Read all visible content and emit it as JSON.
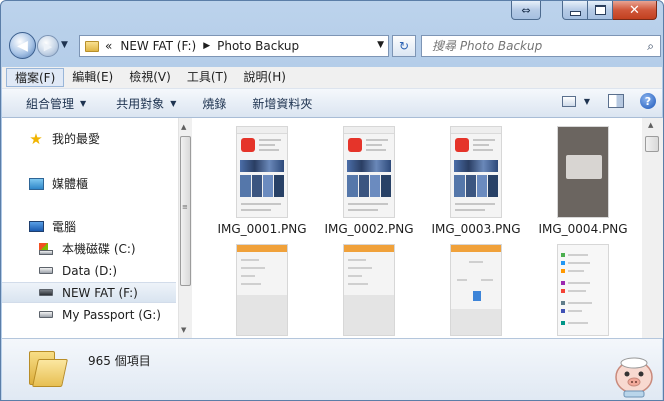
{
  "window": {
    "controls": {
      "minimize": "minimize",
      "maximize": "maximize",
      "close": "close",
      "restore_tb": "restore-down"
    }
  },
  "nav": {
    "breadcrumb_overflow": "«",
    "breadcrumb": [
      "NEW FAT (F:)",
      "Photo Backup"
    ],
    "search_placeholder": "搜尋 Photo Backup"
  },
  "menubar": [
    "檔案(F)",
    "編輯(E)",
    "檢視(V)",
    "工具(T)",
    "說明(H)"
  ],
  "commands": [
    {
      "label": "組合管理",
      "dropdown": true
    },
    {
      "label": "共用對象",
      "dropdown": true
    },
    {
      "label": "燒錄",
      "dropdown": false
    },
    {
      "label": "新增資料夾",
      "dropdown": false
    }
  ],
  "sidebar": {
    "items": [
      {
        "label": "我的最愛",
        "icon": "star-icon"
      },
      {
        "label": "媒體櫃",
        "icon": "library-icon"
      },
      {
        "label": "電腦",
        "icon": "computer-icon"
      },
      {
        "label": "本機磁碟 (C:)",
        "icon": "system-drive-icon"
      },
      {
        "label": "Data (D:)",
        "icon": "drive-icon"
      },
      {
        "label": "NEW FAT (F:)",
        "icon": "usb-drive-icon",
        "selected": true
      },
      {
        "label": "My Passport (G:)",
        "icon": "drive-icon"
      }
    ]
  },
  "files": [
    {
      "name": "IMG_0001.PNG"
    },
    {
      "name": "IMG_0002.PNG"
    },
    {
      "name": "IMG_0003.PNG"
    },
    {
      "name": "IMG_0004.PNG"
    },
    {
      "name": ""
    },
    {
      "name": ""
    },
    {
      "name": ""
    },
    {
      "name": ""
    }
  ],
  "details": {
    "count": "965 個項目"
  },
  "colors": {
    "accent": "#2b62b3",
    "selection": "#d9e4f0",
    "app_red": "#e5342a"
  }
}
